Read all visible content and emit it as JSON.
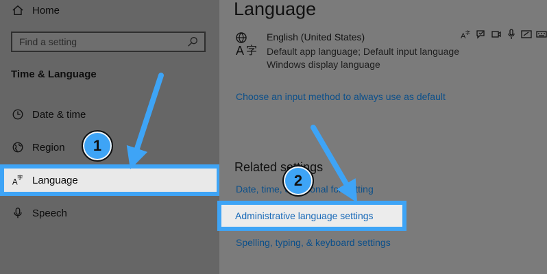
{
  "sidebar": {
    "home_label": "Home",
    "search_placeholder": "Find a setting",
    "section_title": "Time & Language",
    "items": [
      {
        "label": "Date & time"
      },
      {
        "label": "Region"
      },
      {
        "label": "Language"
      },
      {
        "label": "Speech"
      }
    ]
  },
  "main": {
    "title": "Language",
    "language": {
      "name": "English (United States)",
      "line1": "Default app language; Default input language",
      "line2": "Windows display language"
    },
    "input_method_link": "Choose an input method to always use as default",
    "related_title": "Related settings",
    "related_links": [
      "Date, time, & regional formatting",
      "Administrative language settings",
      "Spelling, typing, & keyboard settings"
    ]
  },
  "badges": [
    "1",
    "2"
  ],
  "colors": {
    "highlight": "#3ea4f6",
    "link": "#0b4f8a"
  }
}
